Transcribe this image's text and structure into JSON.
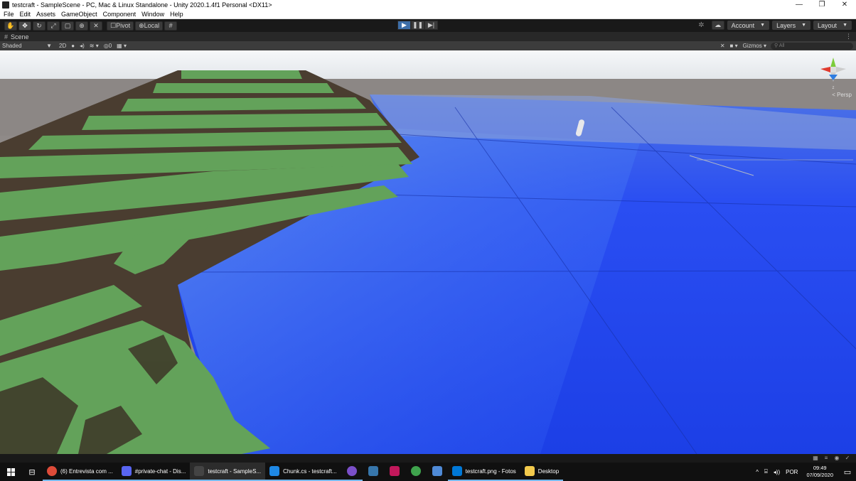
{
  "window": {
    "title": "testcraft - SampleScene - PC, Mac & Linux Standalone - Unity 2020.1.4f1 Personal <DX11>",
    "controls": [
      "—",
      "❐",
      "✕"
    ]
  },
  "menu": [
    "File",
    "Edit",
    "Assets",
    "GameObject",
    "Component",
    "Window",
    "Help"
  ],
  "toolbar": {
    "tools": [
      "hand-tool",
      "move-tool",
      "rotate-tool",
      "scale-tool",
      "rect-tool",
      "transform-tool",
      "custom-tool"
    ],
    "pivot_label": "Pivot",
    "local_label": "Local",
    "account_label": "Account",
    "layers_label": "Layers",
    "layout_label": "Layout"
  },
  "scene_tab": {
    "label": "Scene"
  },
  "scene_bar": {
    "shading_mode": "Shaded",
    "mode_2d": "2D",
    "hidden_count": "0",
    "gizmos_label": "Gizmos",
    "search_placeholder": "All"
  },
  "viewport": {
    "persp_label": "< Persp",
    "colors": {
      "sky": "#f2f5f7",
      "grass": "#5f9b57",
      "dirt": "#4a3b2c",
      "water": "#1f4bff",
      "horizon": "#8f8a88"
    }
  },
  "taskbar": {
    "apps": [
      {
        "label": "(6) Entrevista com ...",
        "icon": "chrome-icon",
        "color": "#dd4b39"
      },
      {
        "label": "#private-chat - Dis...",
        "icon": "discord-icon",
        "color": "#5865f2"
      },
      {
        "label": "testcraft - SampleS...",
        "icon": "unity-icon",
        "color": "#444444"
      },
      {
        "label": "Chunk.cs - testcraft...",
        "icon": "vscode-icon",
        "color": "#1e88e5"
      }
    ],
    "pinned": [
      {
        "icon": "obs-icon",
        "color": "#7b4fc9"
      },
      {
        "icon": "python-icon",
        "color": "#3776ab"
      },
      {
        "icon": "terminal-icon",
        "color": "#c2185b"
      },
      {
        "icon": "node-icon",
        "color": "#3fa34d"
      },
      {
        "icon": "notepad-icon",
        "color": "#4f8ad6"
      }
    ],
    "apps2": [
      {
        "label": "testcraft.png - Fotos",
        "icon": "photos-icon",
        "color": "#0078d7"
      },
      {
        "label": "Desktop",
        "icon": "folder-icon",
        "color": "#f2c94c"
      }
    ],
    "tray": {
      "chevron": "^",
      "language": "POR",
      "time": "09:49",
      "date": "07/09/2020"
    }
  }
}
